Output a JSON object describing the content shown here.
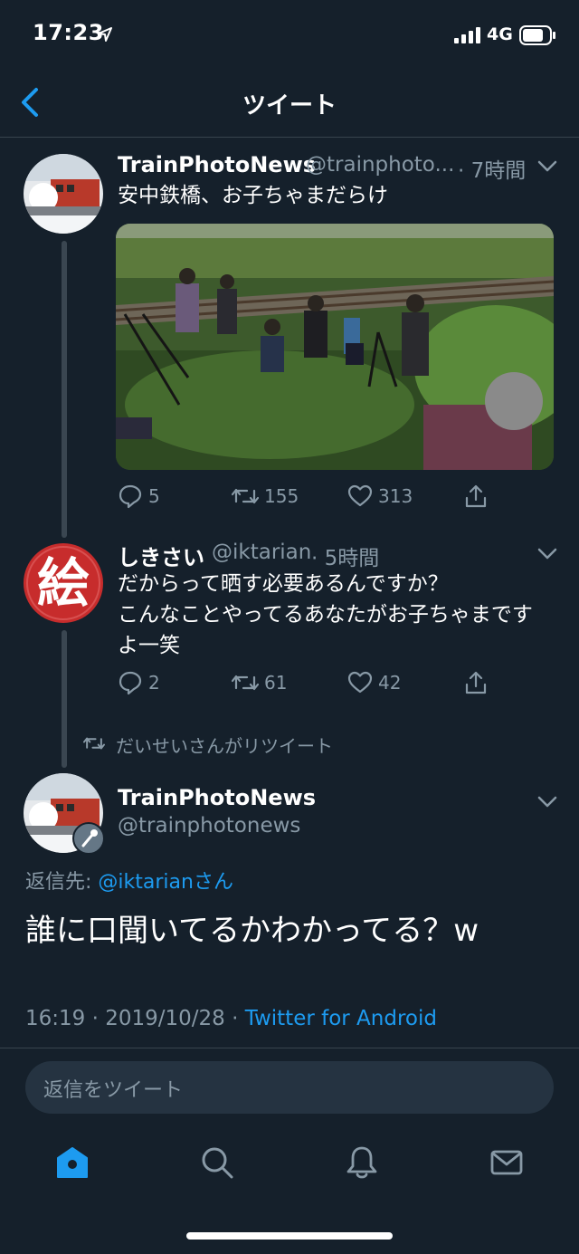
{
  "status_bar": {
    "time": "17:23",
    "network": "4G"
  },
  "nav": {
    "title": "ツイート"
  },
  "tweets": [
    {
      "name": "TrainPhotoNews",
      "handle": "@trainphoto...",
      "time": "· 7時間",
      "text": "安中鉄橋、お子ちゃまだらけ",
      "replies": "5",
      "retweets": "155",
      "likes": "313"
    },
    {
      "name": "しきさい",
      "handle": "@iktarian",
      "time": "· 5時間",
      "avatar_glyph": "絵",
      "text_lines": [
        "だからって晒す必要あるんですか？",
        "こんなことやってるあなたがお子ちゃまです",
        "よ一笑"
      ],
      "replies": "2",
      "retweets": "61",
      "likes": "42"
    }
  ],
  "retweet_notice": "だいせいさんがリツイート",
  "main_tweet": {
    "name": "TrainPhotoNews",
    "handle": "@trainphotonews",
    "reply_to_prefix": "返信先: ",
    "reply_to_mention": "@iktarianさん",
    "text": "誰に口聞いてるかわかってる？w",
    "timestamp": "16:19 · 2019/10/28 · ",
    "client": "Twitter for Android"
  },
  "reply_box": {
    "placeholder": "返信をツイート"
  },
  "tab_bar": [
    "home-icon",
    "search-icon",
    "notifications-icon",
    "messages-icon"
  ],
  "colors": {
    "background": "#15202b",
    "accent": "#1d9bf0",
    "secondary_text": "#8899a6",
    "avatar_red": "#c72c2c"
  }
}
